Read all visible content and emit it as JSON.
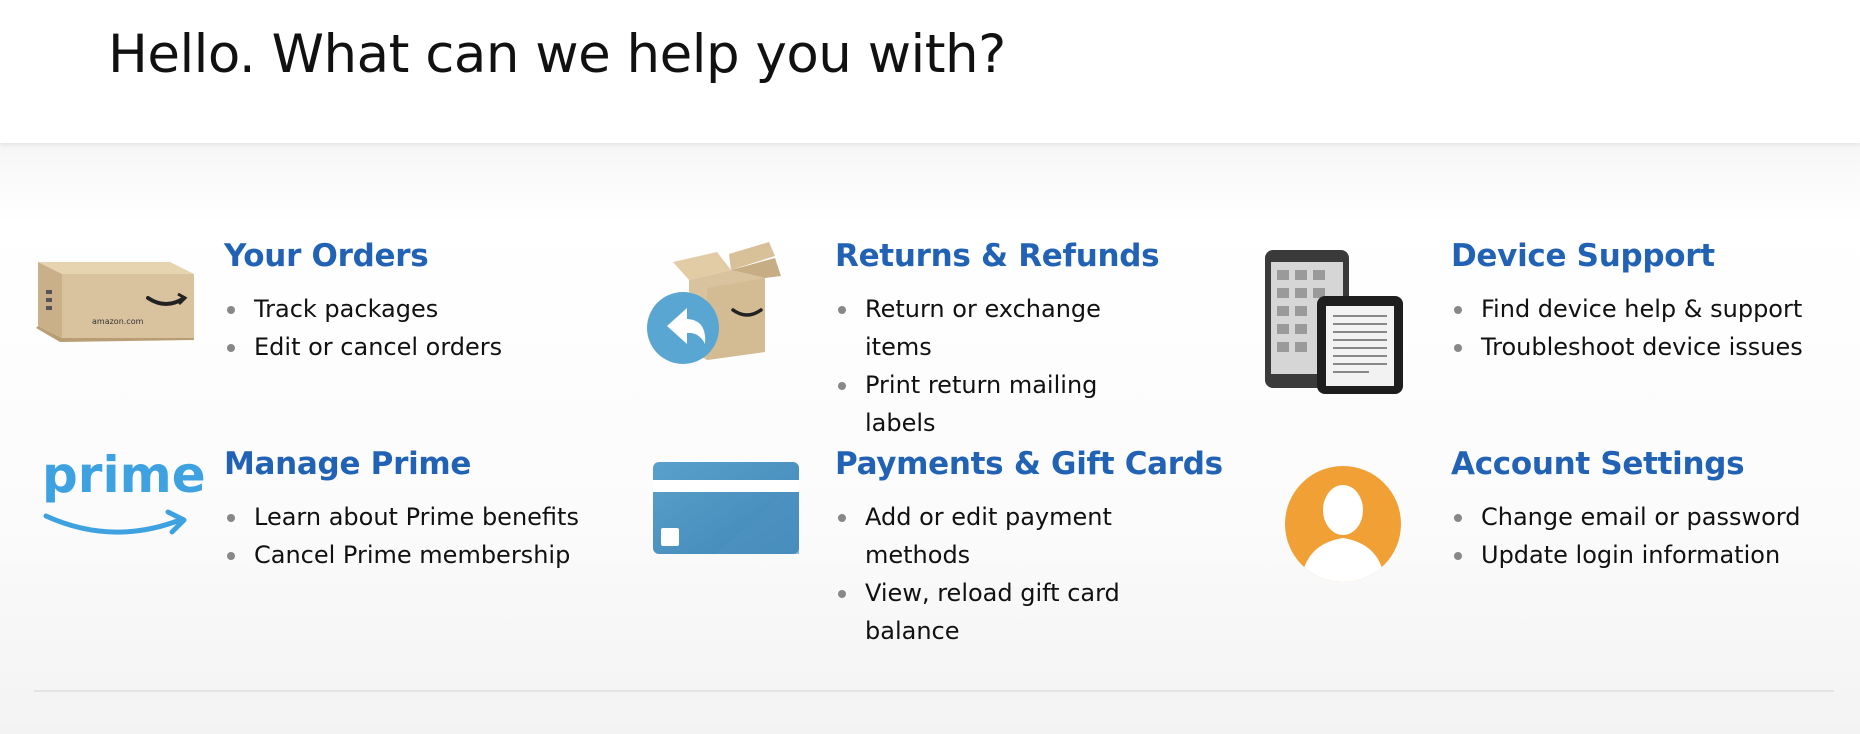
{
  "header": {
    "title": "Hello. What can we help you with?"
  },
  "cards": [
    {
      "title": "Your Orders",
      "icon": "cardboard-box-icon",
      "items": [
        "Track packages",
        "Edit or cancel orders"
      ]
    },
    {
      "title": "Returns & Refunds",
      "icon": "return-box-icon",
      "items": [
        "Return or exchange items",
        "Print return mailing labels"
      ]
    },
    {
      "title": "Device Support",
      "icon": "kindle-devices-icon",
      "items": [
        "Find device help & support",
        "Troubleshoot device issues"
      ]
    },
    {
      "title": "Manage Prime",
      "icon": "prime-logo-icon",
      "items": [
        "Learn about Prime benefits",
        "Cancel Prime membership"
      ]
    },
    {
      "title": "Payments & Gift Cards",
      "icon": "credit-card-icon",
      "items": [
        "Add or edit payment methods",
        "View, reload gift card balance"
      ]
    },
    {
      "title": "Account Settings",
      "icon": "user-avatar-icon",
      "items": [
        "Change email or password",
        "Update login information"
      ]
    }
  ],
  "logos": {
    "box_brand": "amazon.com",
    "prime_logo": "prime"
  },
  "colors": {
    "link": "#2162b5",
    "prime_blue": "#3fa2e0",
    "card_blue": "#4a90bf",
    "avatar_orange": "#f1a035",
    "box_tan": "#d9c39e"
  }
}
